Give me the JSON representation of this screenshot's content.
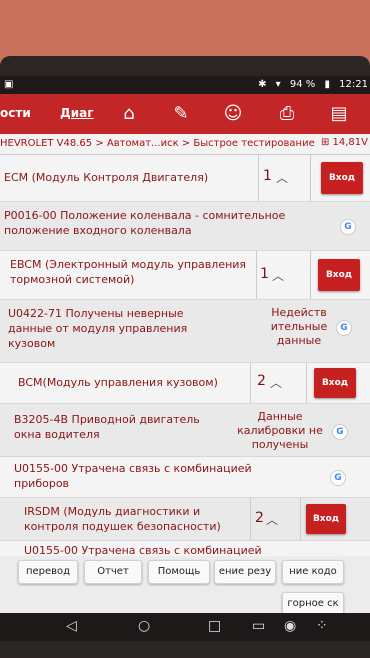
{
  "status_bar": {
    "left_icon": "android-icon",
    "bluetooth": "bluetooth-icon",
    "wifi": "wifi-icon",
    "battery": "94 %",
    "time": "12:21"
  },
  "appbar": {
    "tab_left": "ости",
    "tab_diag": "Диаг",
    "icons": [
      "home-icon",
      "edit-icon",
      "support-icon",
      "print-icon",
      "file-icon"
    ]
  },
  "breadcrumb": {
    "path": "HEVROLET V48.65 > Автомат...иск > Быстрое тестирование",
    "voltage": "14,81V"
  },
  "rows": [
    {
      "text": "ECM (Модуль Контроля Двигателя)",
      "count": "1",
      "button": "Вход"
    },
    {
      "text": "P0016-00 Положение коленвала - сомнительное положение входного коленвала",
      "status": ""
    },
    {
      "text": "EBCM (Электронный модуль управления тормозной системой)",
      "count": "1",
      "button": "Вход"
    },
    {
      "text": "U0422-71 Получены неверные данные от модуля управления кузовом",
      "status": "Недейств ительные данные"
    },
    {
      "text": "BCM(Модуль управления кузовом)",
      "count": "2",
      "button": "Вход"
    },
    {
      "text": "B3205-4B Приводной двигатель окна водителя",
      "status": "Данные калибровки не получены"
    },
    {
      "text": "U0155-00 Утрачена связь с комбинацией приборов",
      "status": ""
    },
    {
      "text": "IRSDM (Модуль диагностики и контроля подушек безопасности)",
      "count": "2",
      "button": "Вход"
    },
    {
      "text": "U0155-00 Утрачена связь с комбинацией",
      "status": ""
    }
  ],
  "bottom": {
    "b1": "перевод",
    "b2": "Отчет",
    "b3": "Помощь",
    "b4": "ение резу",
    "b5": "ние кодо",
    "b6": "горное ск"
  },
  "navbar": {
    "back": "◁",
    "home": "○",
    "recent": "□",
    "i1": "screenshot-icon",
    "i2": "camera-icon",
    "i3": "apps-icon"
  }
}
